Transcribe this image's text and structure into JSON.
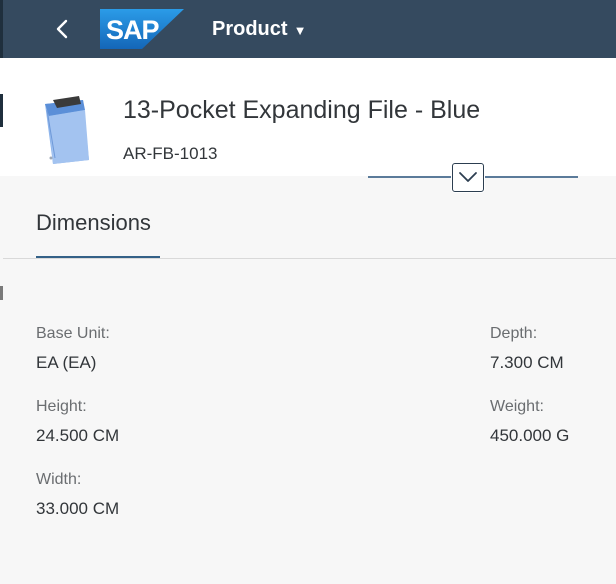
{
  "shell": {
    "logo_text": "SAP",
    "app_title": "Product",
    "colors": {
      "shell_bg": "#354a5f",
      "logo_blue": "#1a75c9",
      "accent": "#346187"
    }
  },
  "header": {
    "title": "13-Pocket Expanding File - Blue",
    "product_id": "AR-FB-1013"
  },
  "tabs": [
    {
      "label": "Dimensions",
      "selected": true
    }
  ],
  "dimensions": {
    "base_unit": {
      "label": "Base Unit:",
      "value": "EA (EA)"
    },
    "height": {
      "label": "Height:",
      "value": "24.500 CM"
    },
    "width": {
      "label": "Width:",
      "value": "33.000 CM"
    },
    "depth": {
      "label": "Depth:",
      "value": "7.300 CM"
    },
    "weight": {
      "label": "Weight:",
      "value": "450.000 G"
    }
  }
}
